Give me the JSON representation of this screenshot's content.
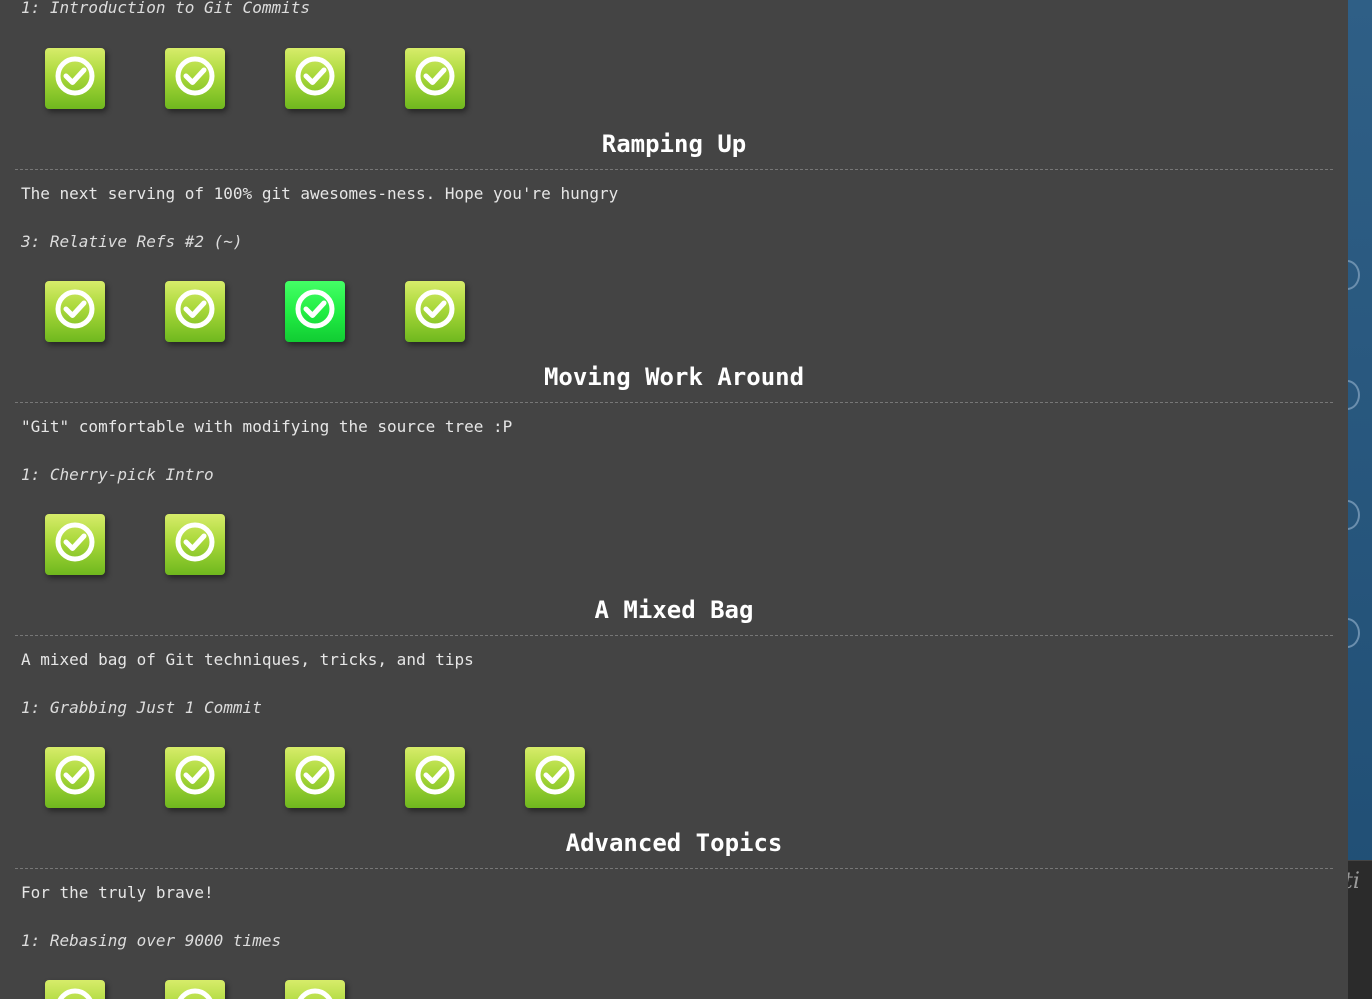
{
  "sections": [
    {
      "level_name": "1: Introduction to Git Commits",
      "icons": [
        {
          "state": "solved"
        },
        {
          "state": "solved"
        },
        {
          "state": "solved"
        },
        {
          "state": "solved"
        }
      ]
    },
    {
      "title": "Ramping Up",
      "about": "The next serving of 100% git awesomes-ness. Hope you're hungry",
      "level_name": "3: Relative Refs #2 (~)",
      "icons": [
        {
          "state": "solved"
        },
        {
          "state": "solved"
        },
        {
          "state": "selected"
        },
        {
          "state": "solved"
        }
      ]
    },
    {
      "title": "Moving Work Around",
      "about": "\"Git\" comfortable with modifying the source tree :P",
      "level_name": "1: Cherry-pick Intro",
      "icons": [
        {
          "state": "solved"
        },
        {
          "state": "solved"
        }
      ]
    },
    {
      "title": "A Mixed Bag",
      "about": "A mixed bag of Git techniques, tricks, and tips",
      "level_name": "1: Grabbing Just 1 Commit",
      "icons": [
        {
          "state": "solved"
        },
        {
          "state": "solved"
        },
        {
          "state": "solved"
        },
        {
          "state": "solved"
        },
        {
          "state": "solved"
        }
      ]
    },
    {
      "title": "Advanced Topics",
      "about": "For the truly brave!",
      "level_name": "1: Rebasing over 9000 times",
      "icons": [
        {
          "state": "solved"
        },
        {
          "state": "solved"
        },
        {
          "state": "solved"
        }
      ]
    }
  ],
  "side_fragment": "ti",
  "icon_name": "checkmark-circle-icon",
  "colors": {
    "background": "#444444",
    "solved_icon": "#a9d83a",
    "selected_icon": "#22ee44",
    "title": "#ffffff"
  }
}
